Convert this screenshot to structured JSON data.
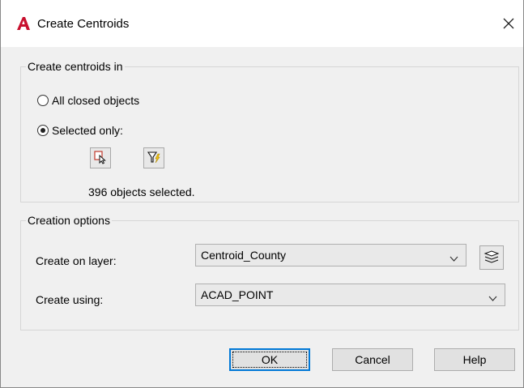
{
  "window": {
    "title": "Create Centroids",
    "app_icon": "autocad-a-icon",
    "close_icon": "close-x-icon"
  },
  "group_centroids": {
    "label": "Create centroids in",
    "option_all": "All closed objects",
    "option_selected": "Selected only:",
    "selected_option": "Selected only:",
    "select_objects_icon": "select-objects-icon",
    "quick_select_icon": "quick-select-filter-icon",
    "status": "396 objects selected."
  },
  "group_options": {
    "label": "Creation options",
    "layer_label": "Create on layer:",
    "layer_value": "Centroid_County",
    "layer_manager_icon": "layer-manager-icon",
    "using_label": "Create using:",
    "using_value": "ACAD_POINT"
  },
  "buttons": {
    "ok": "OK",
    "cancel": "Cancel",
    "help": "Help"
  },
  "colors": {
    "accent": "#0078d7",
    "app_icon": "#c8102e"
  }
}
